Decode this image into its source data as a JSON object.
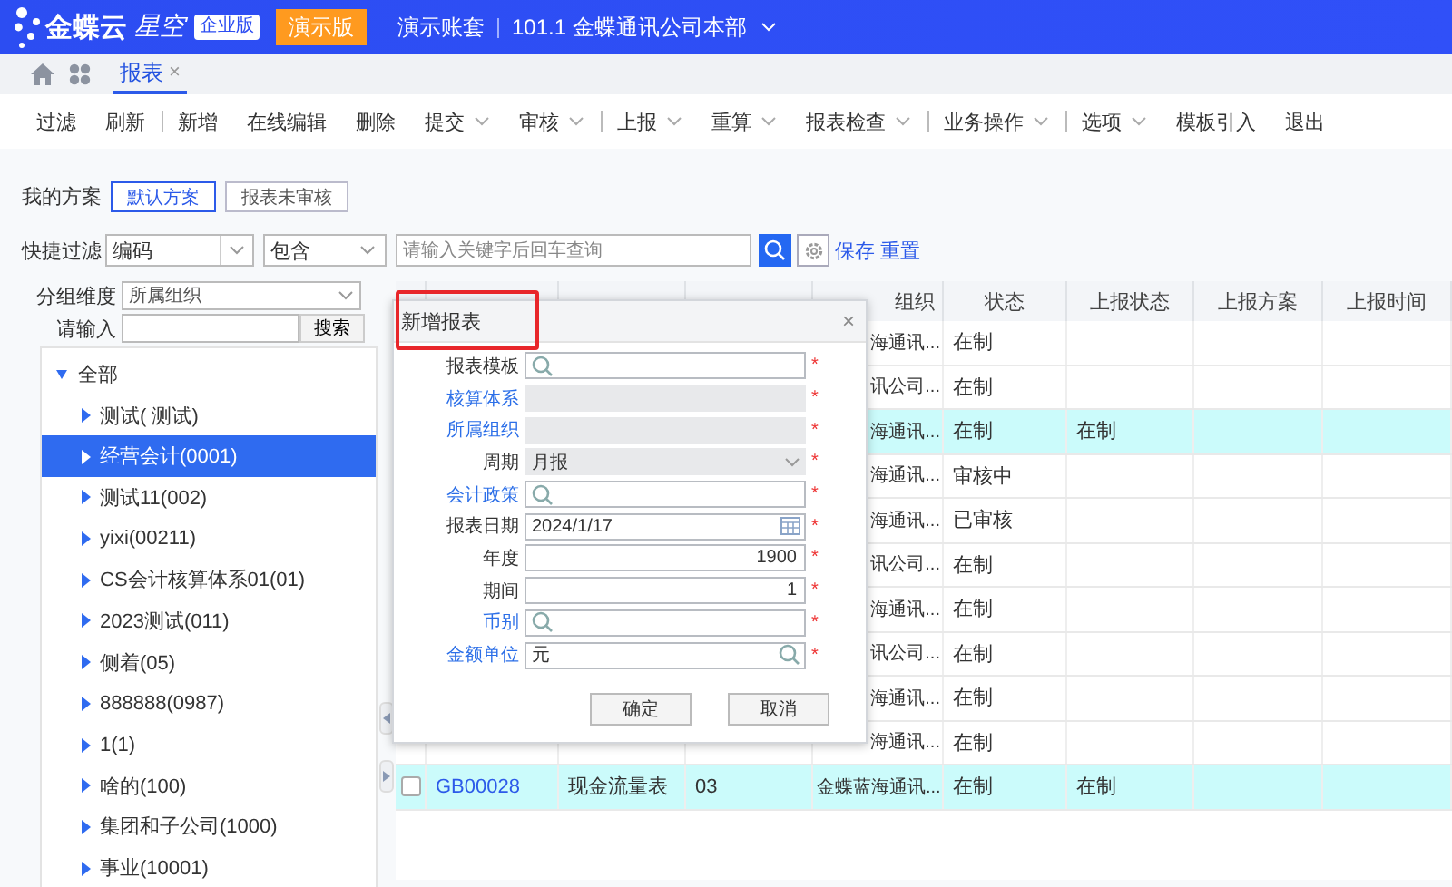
{
  "header": {
    "logo_text": "金蝶云",
    "product": "星空",
    "edition_badge": "企业版",
    "demo_button": "演示版",
    "account": "演示账套",
    "organization": "101.1 金蝶通讯公司本部"
  },
  "tabs": [
    {
      "label": "报表",
      "selected": true,
      "close": "×"
    }
  ],
  "toolbar": [
    {
      "label": "过滤",
      "dropdown": false,
      "divider_after": false
    },
    {
      "label": "刷新",
      "dropdown": false,
      "divider_after": true
    },
    {
      "label": "新增",
      "dropdown": false,
      "divider_after": false
    },
    {
      "label": "在线编辑",
      "dropdown": false,
      "divider_after": false
    },
    {
      "label": "删除",
      "dropdown": false,
      "divider_after": false
    },
    {
      "label": "提交",
      "dropdown": true,
      "divider_after": false
    },
    {
      "label": "审核",
      "dropdown": true,
      "divider_after": true
    },
    {
      "label": "上报",
      "dropdown": true,
      "divider_after": false
    },
    {
      "label": "重算",
      "dropdown": true,
      "divider_after": false
    },
    {
      "label": "报表检查",
      "dropdown": true,
      "divider_after": true
    },
    {
      "label": "业务操作",
      "dropdown": true,
      "divider_after": true
    },
    {
      "label": "选项",
      "dropdown": true,
      "divider_after": false
    },
    {
      "label": "模板引入",
      "dropdown": false,
      "divider_after": false
    },
    {
      "label": "退出",
      "dropdown": false,
      "divider_after": false
    }
  ],
  "schemes": {
    "label": "我的方案",
    "items": [
      {
        "label": "默认方案",
        "selected": true
      },
      {
        "label": "报表未审核",
        "selected": false
      }
    ]
  },
  "quick_filter": {
    "label": "快捷过滤",
    "field": "编码",
    "operator": "包含",
    "placeholder": "请输入关键字后回车查询",
    "save": "保存",
    "reset": "重置"
  },
  "group_panel": {
    "dimension_label": "分组维度",
    "dimension": "所属组织",
    "search_label": "请输入",
    "search_button": "搜索",
    "tree": [
      {
        "label": "全部",
        "expanded": true,
        "selected": false,
        "children": [
          {
            "label": "测试( 测试)",
            "expanded": false,
            "selected": false
          },
          {
            "label": "经营会计(0001)",
            "expanded": false,
            "selected": true
          },
          {
            "label": "测试11(002)",
            "expanded": false,
            "selected": false
          },
          {
            "label": "yixi(00211)",
            "expanded": false,
            "selected": false
          },
          {
            "label": "CS会计核算体系01(01)",
            "expanded": false,
            "selected": false
          },
          {
            "label": "2023测试(011)",
            "expanded": false,
            "selected": false
          },
          {
            "label": "侧着(05)",
            "expanded": false,
            "selected": false
          },
          {
            "label": "888888(0987)",
            "expanded": false,
            "selected": false
          },
          {
            "label": "1(1)",
            "expanded": false,
            "selected": false
          },
          {
            "label": "啥的(100)",
            "expanded": false,
            "selected": false
          },
          {
            "label": "集团和子公司(1000)",
            "expanded": false,
            "selected": false
          },
          {
            "label": "事业(10001)",
            "expanded": false,
            "selected": false
          }
        ]
      }
    ]
  },
  "table": {
    "columns": [
      "组织",
      "状态",
      "上报状态",
      "上报方案",
      "上报时间"
    ],
    "rows": [
      {
        "highlighted": false,
        "organization": "海通讯...",
        "status": "在制"
      },
      {
        "highlighted": false,
        "organization": "讯公司...",
        "status": "在制"
      },
      {
        "highlighted": true,
        "organization": "海通讯...",
        "status": "在制",
        "report_status": "在制"
      },
      {
        "highlighted": false,
        "organization": "海通讯...",
        "status": "审核中"
      },
      {
        "highlighted": false,
        "organization": "海通讯...",
        "status": "已审核"
      },
      {
        "highlighted": false,
        "organization": "讯公司...",
        "status": "在制"
      },
      {
        "highlighted": false,
        "organization": "海通讯...",
        "status": "在制"
      },
      {
        "highlighted": false,
        "organization": "讯公司...",
        "status": "在制"
      },
      {
        "highlighted": false,
        "organization": "海通讯...",
        "status": "在制"
      },
      {
        "highlighted": false,
        "organization": "海通讯...",
        "status": "在制"
      },
      {
        "highlighted": true,
        "checked": false,
        "code": "GB00028",
        "name": "现金流量表",
        "column_3": "03",
        "organization": "金蝶蓝海通讯...",
        "status": "在制",
        "report_status": "在制"
      }
    ]
  },
  "dialog": {
    "title": "新增报表",
    "title_highlighted": true,
    "close": "×",
    "fields": [
      {
        "label": "报表模板",
        "kind": "lookup",
        "link": false,
        "required_mark": "*"
      },
      {
        "label": "核算体系",
        "kind": "disabled",
        "link": true,
        "required_mark": "*"
      },
      {
        "label": "所属组织",
        "kind": "disabled",
        "link": true,
        "required_mark": "*"
      },
      {
        "label": "周期",
        "kind": "select",
        "value": "月报",
        "link": false,
        "required_mark": "*"
      },
      {
        "label": "会计政策",
        "kind": "lookup",
        "link": true,
        "required_mark": "*"
      },
      {
        "label": "报表日期",
        "kind": "date",
        "value": "2024/1/17",
        "link": false,
        "required_mark": "*"
      },
      {
        "label": "年度",
        "kind": "number",
        "value": "1900",
        "link": false,
        "required_mark": "*"
      },
      {
        "label": "期间",
        "kind": "number",
        "value": "1",
        "link": false,
        "required_mark": "*"
      },
      {
        "label": "币别",
        "kind": "lookup",
        "link": true,
        "required_mark": "*"
      },
      {
        "label": "金额单位",
        "kind": "lookup",
        "value": "元",
        "link": true,
        "required_mark": "*"
      }
    ],
    "buttons": [
      "确定",
      "取消"
    ]
  }
}
